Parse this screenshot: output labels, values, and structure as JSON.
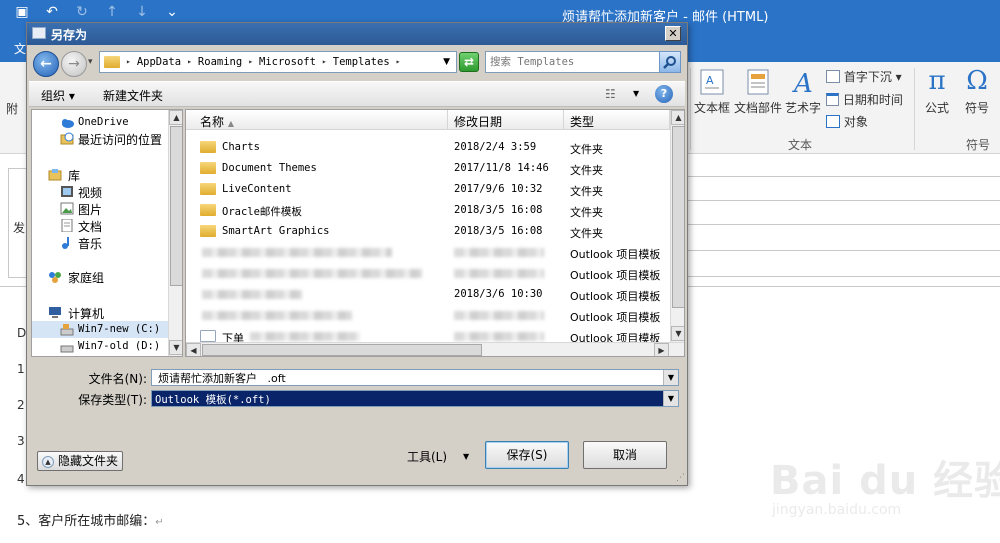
{
  "outlook": {
    "window_title": "烦请帮忙添加新客户   - 邮件 (HTML)",
    "file_tab": "文",
    "left_label": "附",
    "ribbon": {
      "text_box": "文本框",
      "quick_parts": "文档部件",
      "wordart": "艺术字",
      "drop_cap": "首字下沉",
      "date_time": "日期和时间",
      "object": "对象",
      "group_text": "文本",
      "equation": "公式",
      "symbol": "符号",
      "group_symbols": "符号"
    },
    "header_label": "发",
    "body_markers": [
      "D",
      "1",
      "2",
      "3",
      "4"
    ],
    "body_line5": "5、客户所在城市邮编："
  },
  "watermark": {
    "logo": "Bai du 经验",
    "url": "jingyan.baidu.com"
  },
  "dialog": {
    "title": "另存为",
    "close": "✕",
    "address_path": [
      "AppData",
      "Roaming",
      "Microsoft",
      "Templates"
    ],
    "search_placeholder": "搜索 Templates",
    "toolbar": {
      "organize": "组织",
      "new_folder": "新建文件夹"
    },
    "nav": [
      {
        "label": "OneDrive",
        "mono": true
      },
      {
        "label": "最近访问的位置",
        "mono": false
      },
      {
        "label": "库",
        "mono": false
      },
      {
        "label": "视频",
        "mono": false
      },
      {
        "label": "图片",
        "mono": false
      },
      {
        "label": "文档",
        "mono": false
      },
      {
        "label": "音乐",
        "mono": false
      },
      {
        "label": "家庭组",
        "mono": false
      },
      {
        "label": "计算机",
        "mono": false
      },
      {
        "label": "Win7-new (C:)",
        "mono": true
      },
      {
        "label": "Win7-old (D:)",
        "mono": true
      }
    ],
    "columns": {
      "name": "名称",
      "date": "修改日期",
      "type": "类型"
    },
    "files": [
      {
        "name": "Charts",
        "date": "2018/2/4 3:59",
        "type": "文件夹",
        "kind": "folder"
      },
      {
        "name": "Document Themes",
        "date": "2017/11/8 14:46",
        "type": "文件夹",
        "kind": "folder"
      },
      {
        "name": "LiveContent",
        "date": "2017/9/6 10:32",
        "type": "文件夹",
        "kind": "folder"
      },
      {
        "name": "Oracle邮件模板",
        "date": "2018/3/5 16:08",
        "type": "文件夹",
        "kind": "folder"
      },
      {
        "name": "SmartArt Graphics",
        "date": "2018/3/5 16:08",
        "type": "文件夹",
        "kind": "folder"
      },
      {
        "name": "",
        "date": "",
        "type": "Outlook 项目模板",
        "kind": "template"
      },
      {
        "name": "",
        "date": "",
        "type": "Outlook 项目模板",
        "kind": "template"
      },
      {
        "name": "",
        "date": "2018/3/6 10:30",
        "type": "Outlook 项目模板",
        "kind": "template"
      },
      {
        "name": "",
        "date": "",
        "type": "Outlook 项目模板",
        "kind": "template"
      },
      {
        "name": "下单",
        "date": "",
        "type": "Outlook 项目模板",
        "kind": "template"
      }
    ],
    "filename_label": "文件名(N):",
    "filename_value": "烦请帮忙添加新客户   .oft",
    "savetype_label": "保存类型(T):",
    "savetype_value": "Outlook 模板(*.oft)",
    "hide_folders": "隐藏文件夹",
    "tools": "工具(L)",
    "save": "保存(S)",
    "cancel": "取消"
  }
}
